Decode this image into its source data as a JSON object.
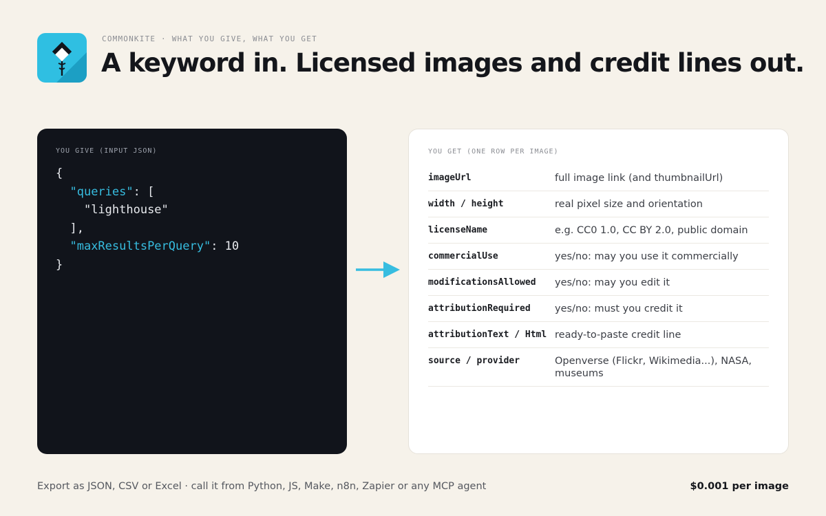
{
  "header": {
    "eyebrow": "COMMONKITE · WHAT YOU GIVE, WHAT YOU GET",
    "title": "A keyword in. Licensed images and credit lines out.",
    "logo_icon": "kite-logo-icon"
  },
  "input_panel": {
    "label": "YOU GIVE (INPUT JSON)",
    "code": {
      "open_brace": "{",
      "queries_key": "\"queries\"",
      "queries_colon": ": [",
      "query_value": "\"lighthouse\"",
      "array_close": "],",
      "max_key": "\"maxResultsPerQuery\"",
      "max_value": ": 10",
      "close_brace": "}"
    }
  },
  "arrow_icon": "arrow-right-icon",
  "output_panel": {
    "label": "YOU GET (ONE ROW PER IMAGE)",
    "rows": [
      {
        "field": "imageUrl",
        "desc": "full image link (and thumbnailUrl)"
      },
      {
        "field": "width / height",
        "desc": "real pixel size and orientation"
      },
      {
        "field": "licenseName",
        "desc": "e.g. CC0 1.0, CC BY 2.0, public domain"
      },
      {
        "field": "commercialUse",
        "desc": "yes/no: may you use it commercially"
      },
      {
        "field": "modificationsAllowed",
        "desc": "yes/no: may you edit it"
      },
      {
        "field": "attributionRequired",
        "desc": "yes/no: must you credit it"
      },
      {
        "field": "attributionText / Html",
        "desc": "ready-to-paste credit line"
      },
      {
        "field": "source / provider",
        "desc": "Openverse (Flickr, Wikimedia...), NASA, museums"
      }
    ]
  },
  "footer": {
    "left": "Export as JSON, CSV or Excel · call it from Python, JS, Make, n8n, Zapier or any MCP agent",
    "price": "$0.001 per image"
  },
  "colors": {
    "background": "#f6f2ea",
    "accent": "#37bde0",
    "code_bg": "#11141b",
    "logo_bg": "#2fbfe2"
  }
}
